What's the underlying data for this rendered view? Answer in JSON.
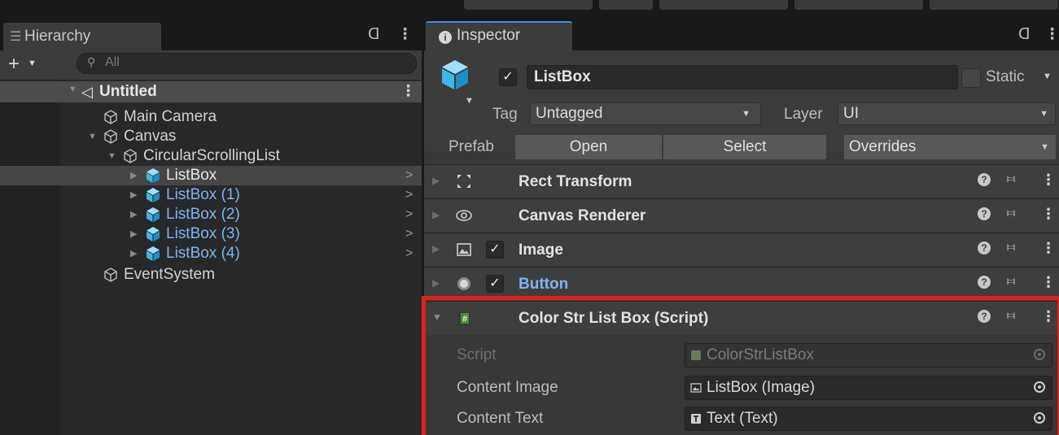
{
  "hierarchy": {
    "tab_label": "Hierarchy",
    "search_placeholder": "All",
    "items": [
      {
        "label": "Untitled"
      },
      {
        "label": "Main Camera"
      },
      {
        "label": "Canvas"
      },
      {
        "label": "CircularScrollingList"
      },
      {
        "label": "ListBox"
      },
      {
        "label": "ListBox (1)"
      },
      {
        "label": "ListBox (2)"
      },
      {
        "label": "ListBox (3)"
      },
      {
        "label": "ListBox (4)"
      },
      {
        "label": "EventSystem"
      }
    ]
  },
  "inspector": {
    "tab_label": "Inspector",
    "object_name": "ListBox",
    "static_label": "Static",
    "tag_label": "Tag",
    "tag_value": "Untagged",
    "layer_label": "Layer",
    "layer_value": "UI",
    "prefab_label": "Prefab",
    "prefab_open": "Open",
    "prefab_select": "Select",
    "prefab_overrides": "Overrides",
    "components": [
      {
        "title": "Rect Transform"
      },
      {
        "title": "Canvas Renderer"
      },
      {
        "title": "Image"
      },
      {
        "title": "Button"
      },
      {
        "title": "Color Str List Box (Script)"
      }
    ],
    "script_props": [
      {
        "label": "Script",
        "value": "ColorStrListBox"
      },
      {
        "label": "Content Image",
        "value": "ListBox (Image)"
      },
      {
        "label": "Content Text",
        "value": "Text (Text)"
      }
    ]
  },
  "colors": {
    "highlight": "#e41e1e",
    "prefab_blue": "#7cb4f4",
    "tab_accent": "#3d8ee4"
  }
}
